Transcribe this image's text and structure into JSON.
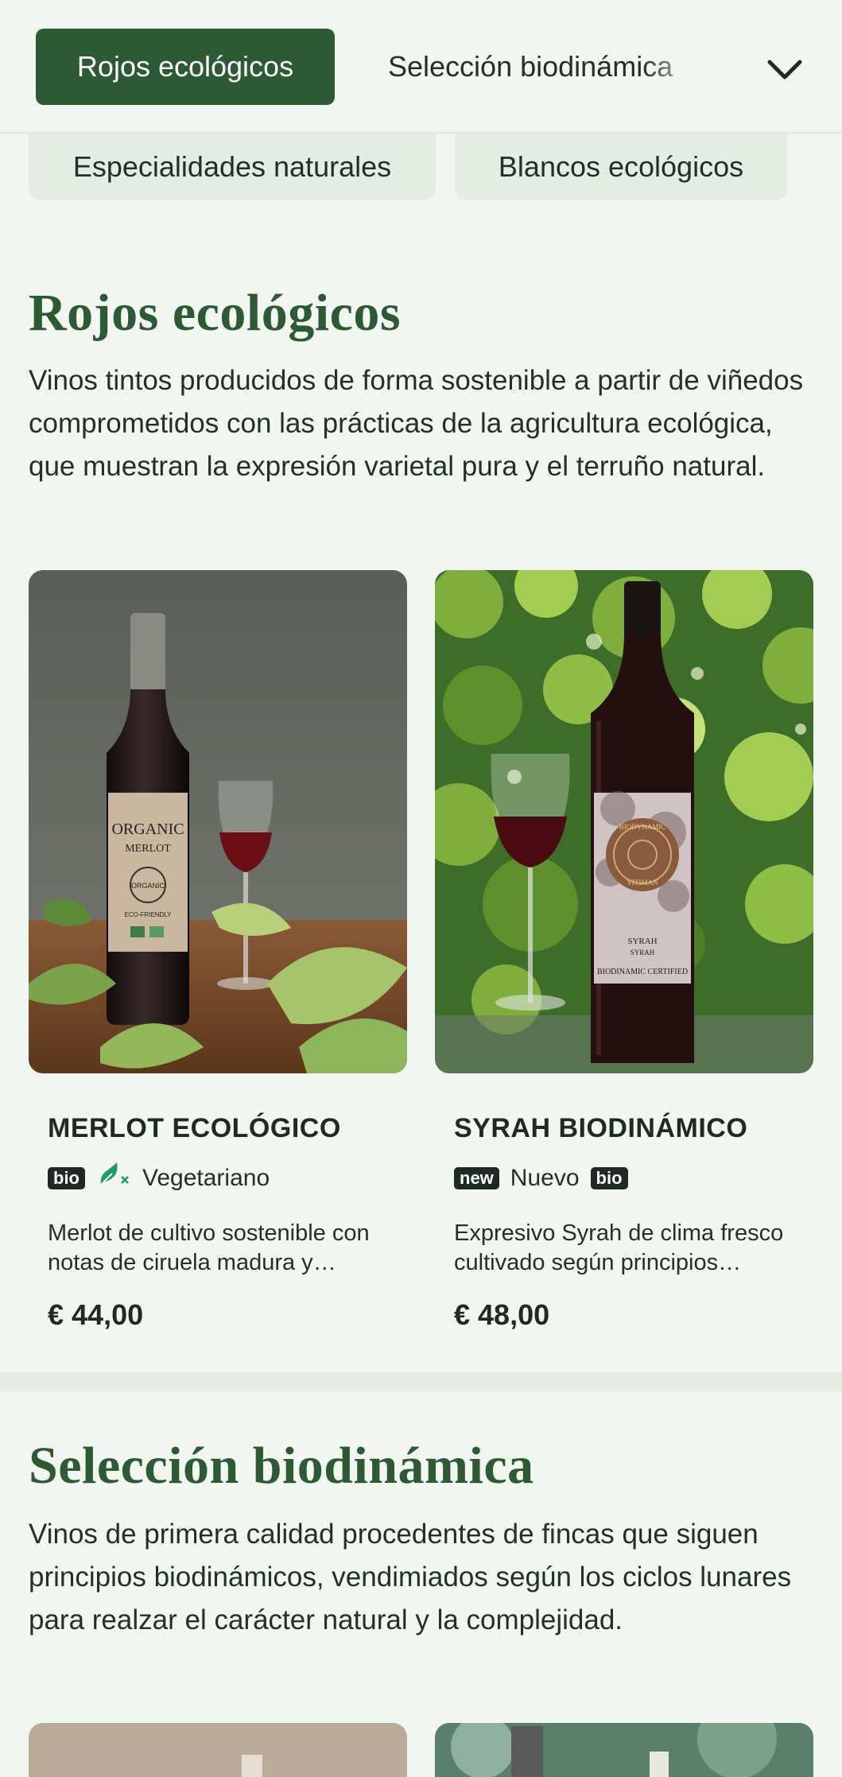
{
  "nav": {
    "active_pill": "Rojos ecológicos",
    "next_pill": "Selección biodinámica",
    "row2": [
      "Especialidades naturales",
      "Blancos ecológicos"
    ]
  },
  "sections": [
    {
      "title": "Rojos ecológicos",
      "description": "Vinos tintos producidos de forma sostenible a partir de viñedos comprometidos con las prácticas de la agricultura ecológica, que muestran la expresión varietal pura y el terruño natural.",
      "products": [
        {
          "name": "MERLOT ECOLÓGICO",
          "badge": "bio",
          "tag_label": "Vegetariano",
          "tag_icon": "vegetarian-icon",
          "description": "Merlot de cultivo sostenible con notas de ciruela madura y suaves taninos.",
          "price": "€ 44,00",
          "label_text": {
            "l1": "ORGANIC",
            "l2": "MERLOT",
            "seal": "ORGANIC",
            "eco": "ECO-FRIENDLY"
          }
        },
        {
          "name": "SYRAH BIODINÁMICO",
          "badge_new": "new",
          "tag_label": "Nuevo",
          "badge": "bio",
          "description": "Expresivo Syrah de clima fresco cultivado según principios biodinámicos.",
          "price": "€ 48,00",
          "label_text": {
            "arc_top": "BIODYNAMIC",
            "arc_bottom": "VITIMAN",
            "l1": "SYRAH",
            "l2": "SYRAH",
            "cert": "BIODINAMIC CERTIFIED"
          }
        }
      ]
    },
    {
      "title": "Selección biodinámica",
      "description": "Vinos de primera calidad procedentes de fincas que siguen principios biodinámicos, vendimiados según los ciclos lunares para realzar el carácter natural y la complejidad."
    }
  ],
  "colors": {
    "accent": "#2d5a34",
    "background": "#f2f6f1",
    "soft_pill": "#e5ece4",
    "badge": "#1f2a24",
    "veg_icon": "#1f9a6a"
  },
  "icons": {
    "dropdown": "chevron-down-icon"
  }
}
